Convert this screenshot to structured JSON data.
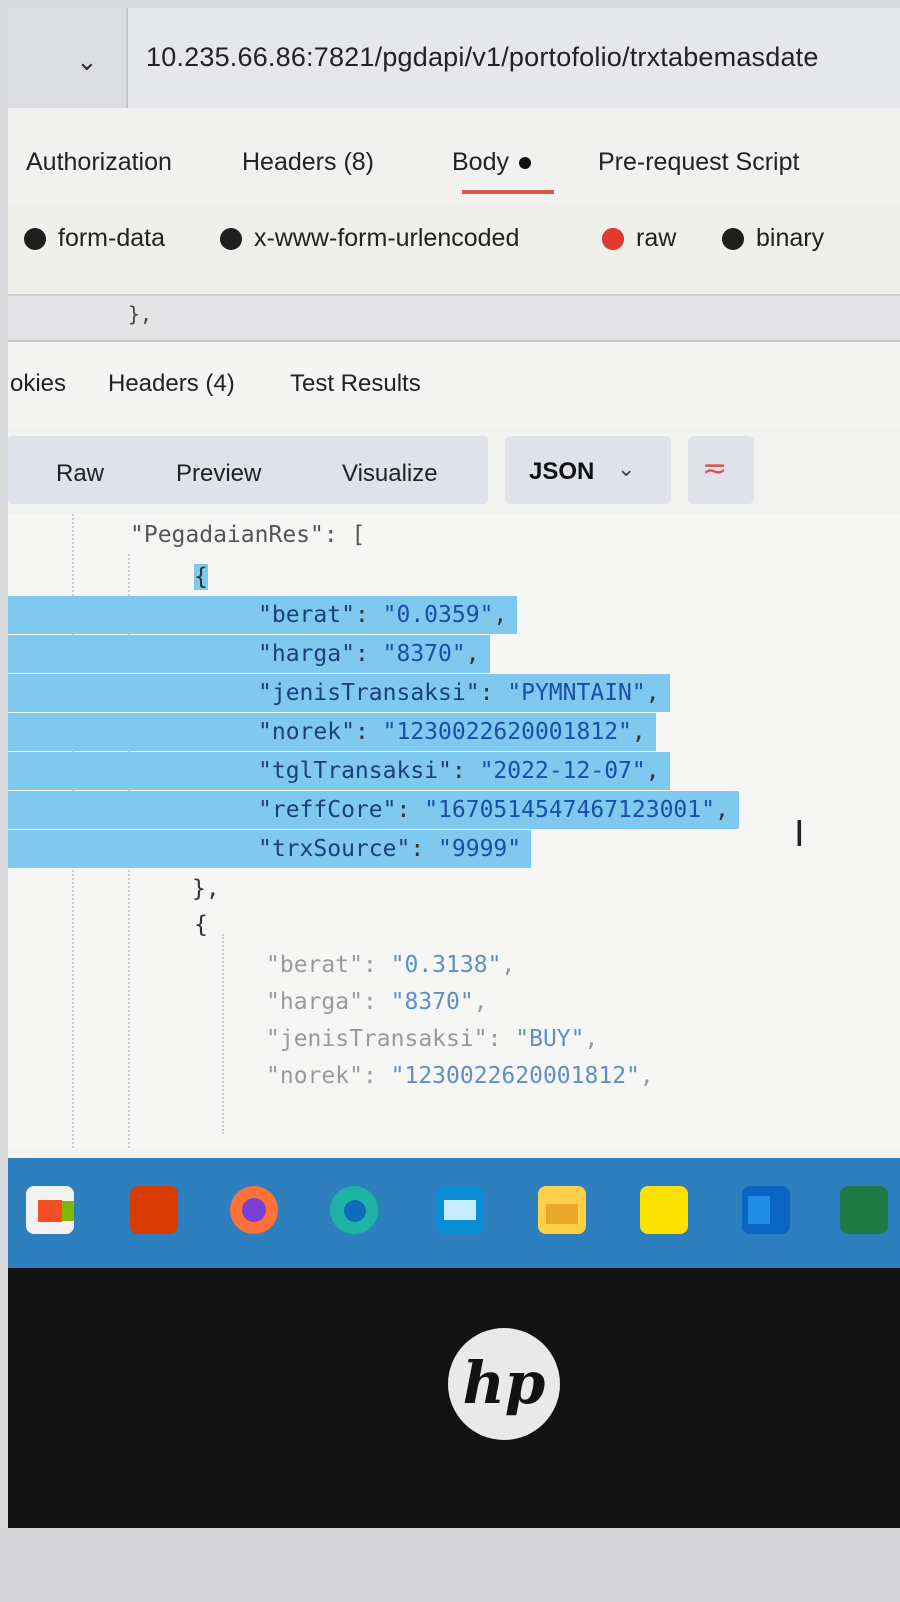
{
  "url": {
    "text": "10.235.66.86:7821/pgdapi/v1/portofolio/trxtabemasdate"
  },
  "request_tabs": [
    "Authorization",
    "Headers (8)",
    "Body",
    "Pre-request Script"
  ],
  "body_types": [
    "form-data",
    "x-www-form-urlencoded",
    "raw",
    "binary"
  ],
  "body_type_selected": "raw",
  "strip_snippet": "},",
  "response_tabs": [
    "okies",
    "Headers (4)",
    "Test Results"
  ],
  "viewer_modes": [
    "Raw",
    "Preview",
    "Visualize"
  ],
  "format": "JSON",
  "code": {
    "root_key": "\"PegadaianRes\": [",
    "open_brace": "{",
    "entry1": [
      {
        "key": "\"berat\"",
        "value": "\"0.0359\"",
        "sep": ","
      },
      {
        "key": "\"harga\"",
        "value": "\"8370\"",
        "sep": ","
      },
      {
        "key": "\"jenisTransaksi\"",
        "value": "\"PYMNTAIN\"",
        "sep": ","
      },
      {
        "key": "\"norek\"",
        "value": "\"1230022620001812\"",
        "sep": ","
      },
      {
        "key": "\"tglTransaksi\"",
        "value": "\"2022-12-07\"",
        "sep": ","
      },
      {
        "key": "\"reffCore\"",
        "value": "\"1670514547467123001\"",
        "sep": ","
      },
      {
        "key": "\"trxSource\"",
        "value": "\"9999\"",
        "sep": ""
      }
    ],
    "close_brace": "},",
    "open_brace2": "{",
    "entry2": [
      {
        "key": "\"berat\"",
        "value": "\"0.3138\"",
        "sep": ","
      },
      {
        "key": "\"harga\"",
        "value": "\"8370\"",
        "sep": ","
      },
      {
        "key": "\"jenisTransaksi\"",
        "value": "\"BUY\"",
        "sep": ","
      },
      {
        "key": "\"norek\"",
        "value": "\"1230022620001812\"",
        "sep": ","
      }
    ]
  },
  "taskbar_icons": [
    "store-icon",
    "office-icon",
    "firefox-icon",
    "edge-icon",
    "mail-icon",
    "file-explorer-icon",
    "sticky-notes-icon",
    "outlook-icon",
    "excel-icon"
  ],
  "monitor_brand": "hp",
  "colors": {
    "selection": "#7fc9ee",
    "json_value": "#1b4ea6",
    "active_tab_underline": "#d9534f",
    "taskbar": "#2d7fbd"
  }
}
